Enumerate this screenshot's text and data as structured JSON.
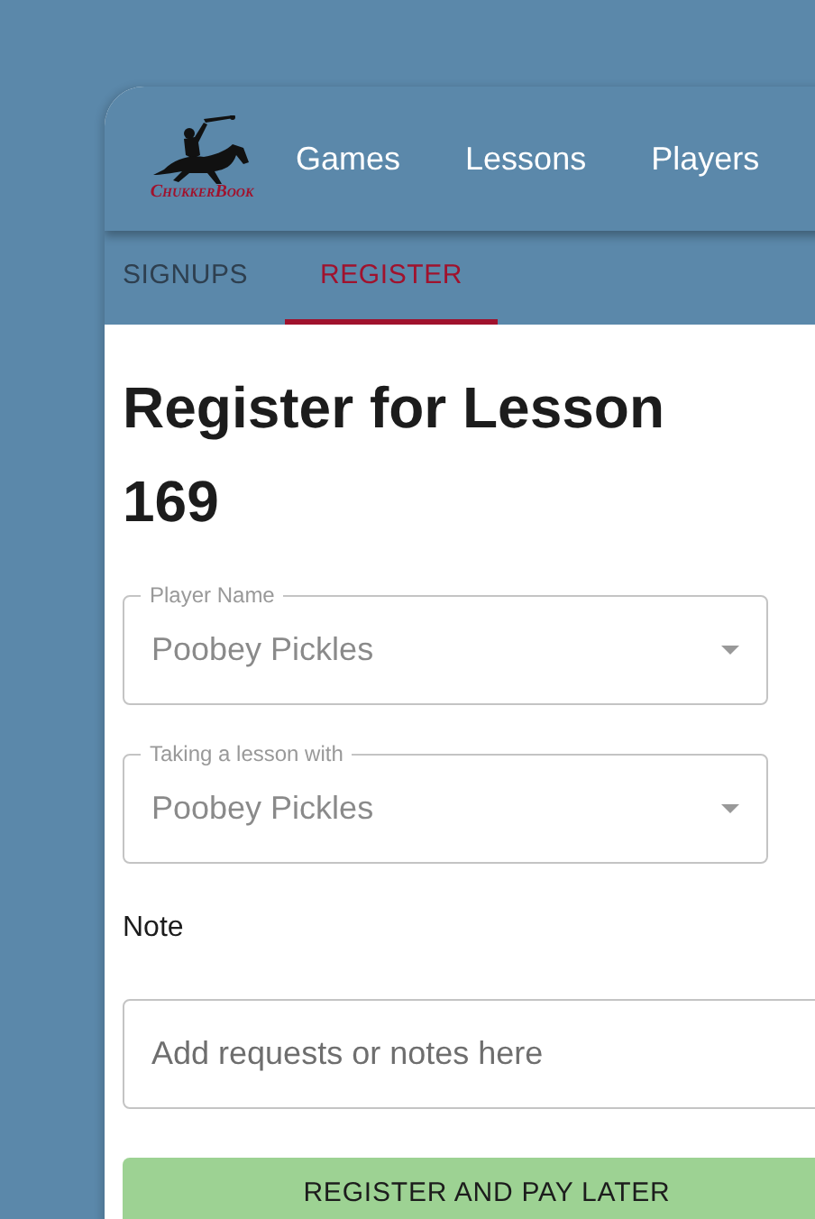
{
  "logo": {
    "text": "ChukkerBook"
  },
  "nav": [
    {
      "label": "Games"
    },
    {
      "label": "Lessons"
    },
    {
      "label": "Players"
    }
  ],
  "tabs": [
    {
      "label": "SIGNUPS",
      "selected": false
    },
    {
      "label": "REGISTER",
      "selected": true
    }
  ],
  "heading": "Register for Lesson 169",
  "selects": [
    {
      "label": "Player Name",
      "value": "Poobey Pickles"
    },
    {
      "label": "Taking a lesson with",
      "value": "Poobey Pickles"
    }
  ],
  "note": {
    "label": "Note",
    "placeholder": "Add requests or notes here"
  },
  "button": "REGISTER AND PAY LATER"
}
